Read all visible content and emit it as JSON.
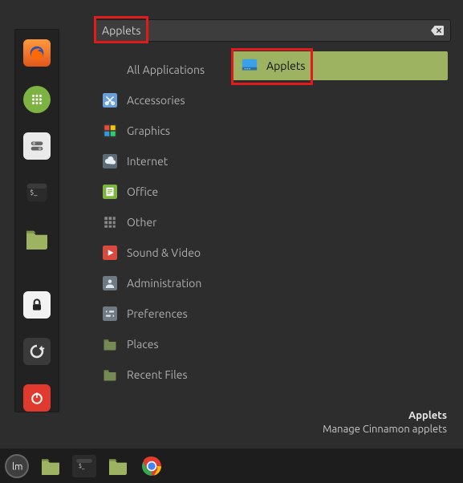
{
  "search": {
    "value": "Applets"
  },
  "favorites": [
    {
      "name": "firefox",
      "svg": "firefox"
    },
    {
      "name": "apps",
      "svg": "apps"
    },
    {
      "name": "settings",
      "svg": "settings"
    },
    {
      "name": "terminal",
      "svg": "terminal"
    },
    {
      "name": "files",
      "svg": "files"
    }
  ],
  "session": [
    {
      "name": "lock",
      "svg": "lock"
    },
    {
      "name": "logout",
      "svg": "logout"
    },
    {
      "name": "power",
      "svg": "power"
    }
  ],
  "categories": [
    {
      "label": "All Applications",
      "icon": ""
    },
    {
      "label": "Accessories",
      "icon": "scissors"
    },
    {
      "label": "Graphics",
      "icon": "palette"
    },
    {
      "label": "Internet",
      "icon": "cloud"
    },
    {
      "label": "Office",
      "icon": "office"
    },
    {
      "label": "Other",
      "icon": "grid"
    },
    {
      "label": "Sound & Video",
      "icon": "play"
    },
    {
      "label": "Administration",
      "icon": "admin"
    },
    {
      "label": "Preferences",
      "icon": "prefs"
    },
    {
      "label": "Places",
      "icon": "folder"
    },
    {
      "label": "Recent Files",
      "icon": "folder"
    }
  ],
  "results": [
    {
      "label": "Applets",
      "icon": "applet"
    }
  ],
  "description": {
    "title": "Applets",
    "subtitle": "Manage Cinnamon applets"
  },
  "panel": [
    {
      "name": "files",
      "svg": "files-light"
    },
    {
      "name": "terminal",
      "svg": "terminal"
    },
    {
      "name": "files2",
      "svg": "files-light"
    },
    {
      "name": "chrome",
      "svg": "chrome"
    }
  ]
}
